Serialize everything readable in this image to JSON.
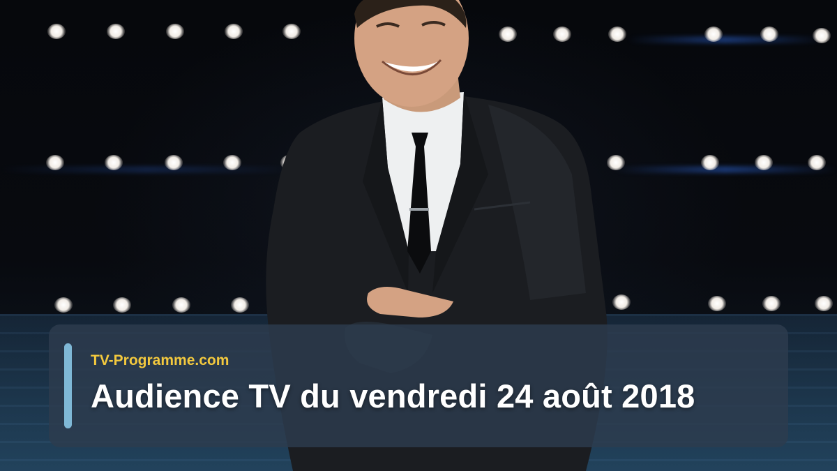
{
  "banner": {
    "site_name": "TV-Programme.com",
    "headline": "Audience TV du vendredi 24 août 2018"
  },
  "colors": {
    "site_name": "#f3c93e",
    "headline": "#ffffff",
    "accent_bar": "#7fb8d6",
    "banner_background": "#2d3c4e"
  },
  "photo": {
    "icon": "presenter-photo"
  }
}
